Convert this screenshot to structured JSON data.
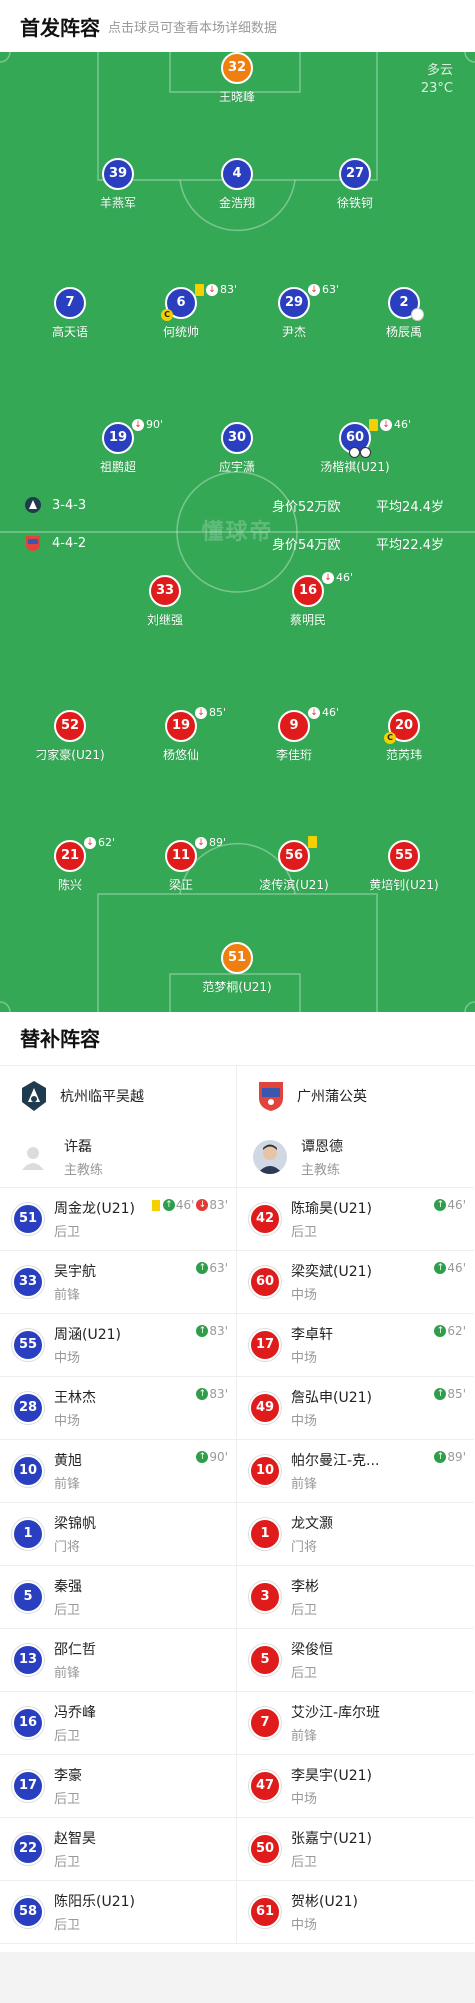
{
  "header": {
    "title": "首发阵容",
    "hint": "点击球员可查看本场详细数据"
  },
  "weather": {
    "condition": "多云",
    "temperature": "23°C"
  },
  "watermark": "懂球帝",
  "home_info": {
    "formation": "3-4-3",
    "value": "身价52万欧",
    "avg_age": "平均24.4岁"
  },
  "away_info": {
    "formation": "4-4-2",
    "value": "身价54万欧",
    "avg_age": "平均22.4岁"
  },
  "colors": {
    "pitch": "#35a855",
    "home": "#2a3fbf",
    "away": "#e01b1b",
    "keeper": "#f07f12"
  },
  "home_lineup": [
    {
      "number": "32",
      "name": "王晓峰"
    },
    {
      "number": "39",
      "name": "羊燕军"
    },
    {
      "number": "4",
      "name": "金浩翔"
    },
    {
      "number": "27",
      "name": "徐铁钶"
    },
    {
      "number": "7",
      "name": "高天语"
    },
    {
      "number": "6",
      "name": "何统帅",
      "event": "83'"
    },
    {
      "number": "29",
      "name": "尹杰",
      "event": "63'"
    },
    {
      "number": "2",
      "name": "杨辰禹"
    },
    {
      "number": "19",
      "name": "祖鹏超",
      "event": "90'"
    },
    {
      "number": "30",
      "name": "应宇潇"
    },
    {
      "number": "60",
      "name": "汤楷祺(U21)",
      "event": "46'"
    }
  ],
  "away_lineup": [
    {
      "number": "33",
      "name": "刘继强"
    },
    {
      "number": "16",
      "name": "蔡明民",
      "event": "46'"
    },
    {
      "number": "52",
      "name": "刁家豪(U21)"
    },
    {
      "number": "19",
      "name": "杨悠仙",
      "event": "85'"
    },
    {
      "number": "9",
      "name": "李佳珩",
      "event": "46'"
    },
    {
      "number": "20",
      "name": "范芮玮"
    },
    {
      "number": "21",
      "name": "陈兴",
      "event": "62'"
    },
    {
      "number": "11",
      "name": "梁正",
      "event": "89'"
    },
    {
      "number": "56",
      "name": "凌传滨(U21)"
    },
    {
      "number": "55",
      "name": "黄培钊(U21)"
    },
    {
      "number": "51",
      "name": "范梦桐(U21)"
    }
  ],
  "subs": {
    "title": "替补阵容",
    "home": {
      "team": "杭州临平吴越",
      "coach": {
        "name": "许磊",
        "role": "主教练"
      },
      "players": [
        {
          "number": "51",
          "name": "周金龙(U21)",
          "position": "后卫",
          "in": "46'",
          "out": "83'"
        },
        {
          "number": "33",
          "name": "吴宇航",
          "position": "前锋",
          "in": "63'"
        },
        {
          "number": "55",
          "name": "周涵(U21)",
          "position": "中场",
          "in": "83'"
        },
        {
          "number": "28",
          "name": "王林杰",
          "position": "中场",
          "in": "83'"
        },
        {
          "number": "10",
          "name": "黄旭",
          "position": "前锋",
          "in": "90'"
        },
        {
          "number": "1",
          "name": "梁锦帆",
          "position": "门将"
        },
        {
          "number": "5",
          "name": "秦强",
          "position": "后卫"
        },
        {
          "number": "13",
          "name": "邵仁哲",
          "position": "前锋"
        },
        {
          "number": "16",
          "name": "冯乔峰",
          "position": "后卫"
        },
        {
          "number": "17",
          "name": "李豪",
          "position": "后卫"
        },
        {
          "number": "22",
          "name": "赵智昊",
          "position": "后卫"
        },
        {
          "number": "58",
          "name": "陈阳乐(U21)",
          "position": "后卫"
        }
      ]
    },
    "away": {
      "team": "广州蒲公英",
      "coach": {
        "name": "谭恩德",
        "role": "主教练"
      },
      "players": [
        {
          "number": "42",
          "name": "陈瑜昊(U21)",
          "position": "后卫",
          "in": "46'"
        },
        {
          "number": "60",
          "name": "梁奕斌(U21)",
          "position": "中场",
          "in": "46'"
        },
        {
          "number": "17",
          "name": "李卓轩",
          "position": "中场",
          "in": "62'"
        },
        {
          "number": "49",
          "name": "詹弘申(U21)",
          "position": "中场",
          "in": "85'"
        },
        {
          "number": "10",
          "name": "帕尔曼江-克...",
          "position": "前锋",
          "in": "89'"
        },
        {
          "number": "1",
          "name": "龙文灏",
          "position": "门将"
        },
        {
          "number": "3",
          "name": "李彬",
          "position": "后卫"
        },
        {
          "number": "5",
          "name": "梁俊恒",
          "position": "后卫"
        },
        {
          "number": "7",
          "name": "艾沙江-库尔班",
          "position": "前锋"
        },
        {
          "number": "47",
          "name": "李昊宇(U21)",
          "position": "中场"
        },
        {
          "number": "50",
          "name": "张嘉宁(U21)",
          "position": "后卫"
        },
        {
          "number": "61",
          "name": "贺彬(U21)",
          "position": "中场"
        }
      ]
    }
  }
}
